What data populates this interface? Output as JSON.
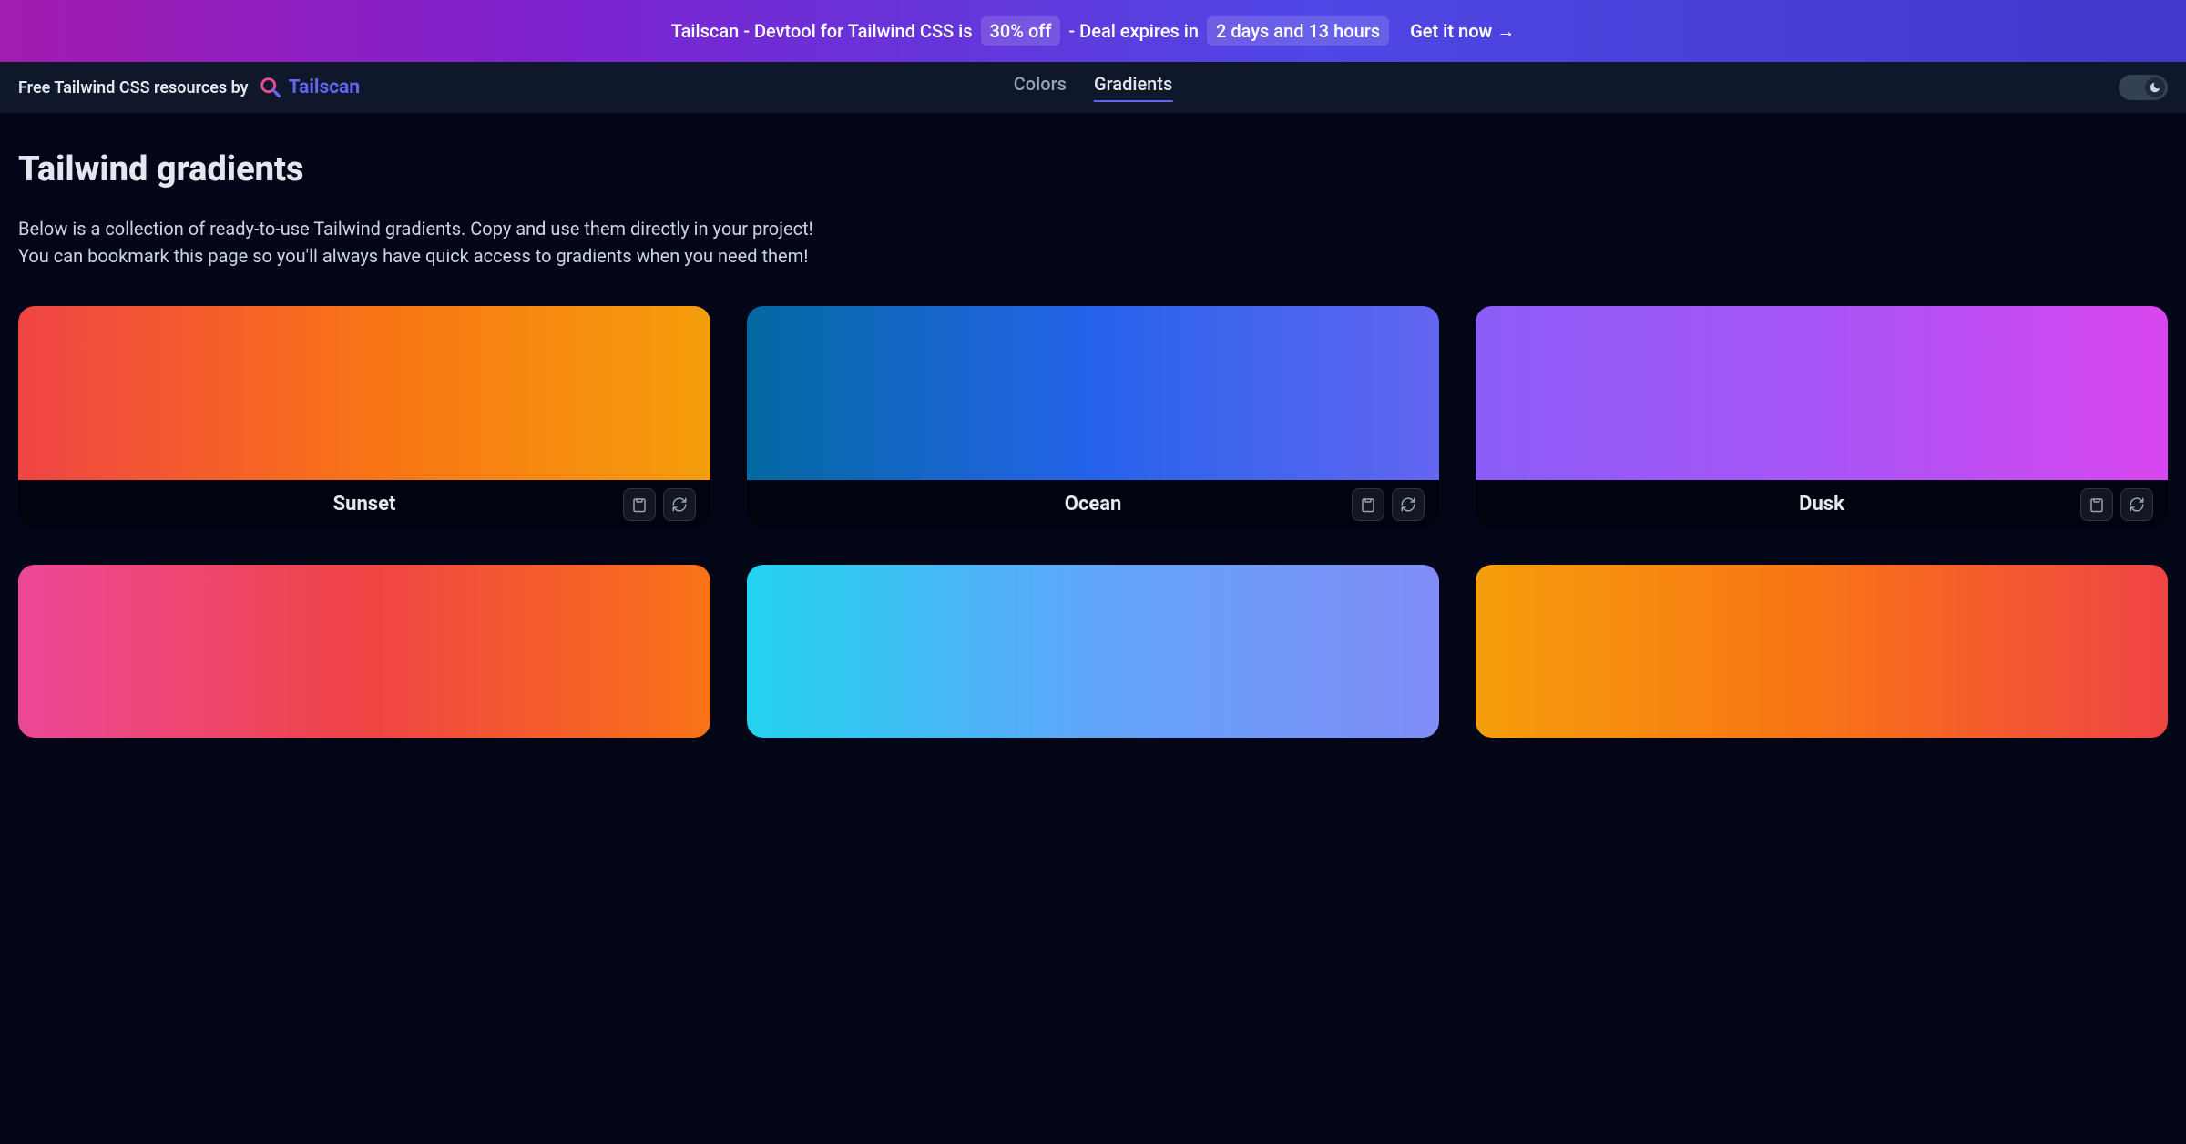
{
  "banner": {
    "prefix": "Tailscan - Devtool for Tailwind CSS is",
    "discount": "30% off",
    "middle": "- Deal expires in",
    "countdown": "2 days and 13 hours",
    "cta": "Get it now →"
  },
  "navbar": {
    "tagline": "Free Tailwind CSS resources by",
    "brand": "Tailscan",
    "tabs": [
      {
        "label": "Colors",
        "active": false
      },
      {
        "label": "Gradients",
        "active": true
      }
    ]
  },
  "page": {
    "title": "Tailwind gradients",
    "desc_line1": "Below is a collection of ready-to-use Tailwind gradients. Copy and use them directly in your project!",
    "desc_line2": "You can bookmark this page so you'll always have quick access to gradients when you need them!"
  },
  "gradients": [
    {
      "name": "Sunset",
      "class": "g-sunset"
    },
    {
      "name": "Ocean",
      "class": "g-ocean"
    },
    {
      "name": "Dusk",
      "class": "g-dusk"
    },
    {
      "name": "",
      "class": "g-4"
    },
    {
      "name": "",
      "class": "g-5"
    },
    {
      "name": "",
      "class": "g-6"
    }
  ]
}
